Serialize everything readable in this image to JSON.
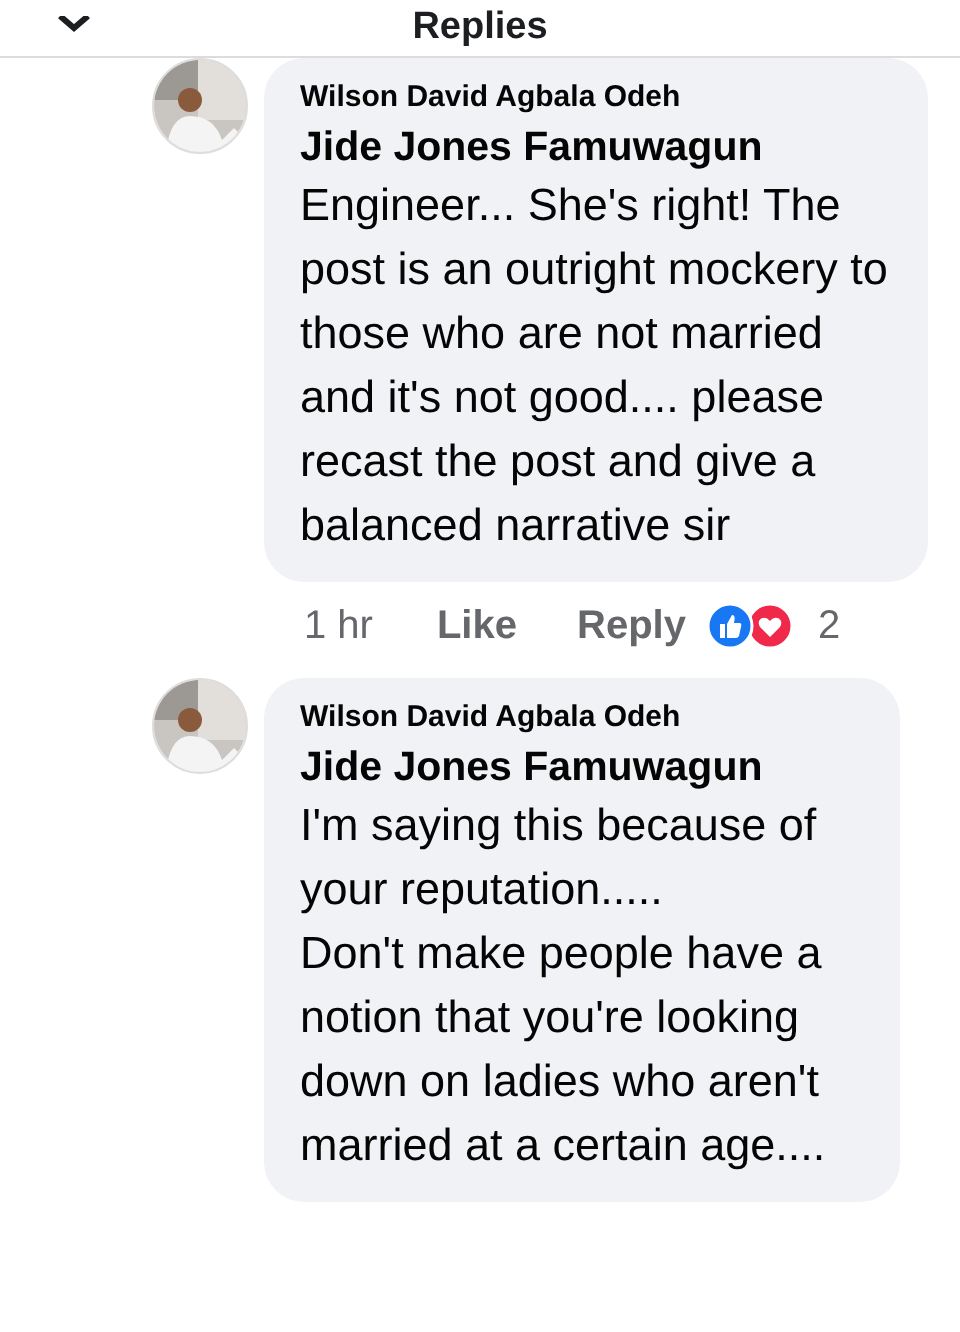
{
  "header": {
    "title": "Replies"
  },
  "comments": [
    {
      "author": "Wilson David Agbala Odeh",
      "mention": "Jide Jones Famuwagun",
      "paragraphs": [
        "Engineer... She's right! The post is an outright mockery to those who are not married and it's not good.... please recast the post and give a balanced narrative sir"
      ],
      "time": "1 hr",
      "actions": [
        "Like",
        "Reply"
      ],
      "reactions": [
        {
          "kind": "like"
        },
        {
          "kind": "love"
        }
      ],
      "reaction_count": "2"
    },
    {
      "author": "Wilson David Agbala Odeh",
      "mention": "Jide Jones Famuwagun",
      "paragraphs": [
        "I'm saying this because of your reputation.....",
        "Don't make people have a notion that you're looking down on ladies who aren't married at a certain age...."
      ]
    }
  ]
}
